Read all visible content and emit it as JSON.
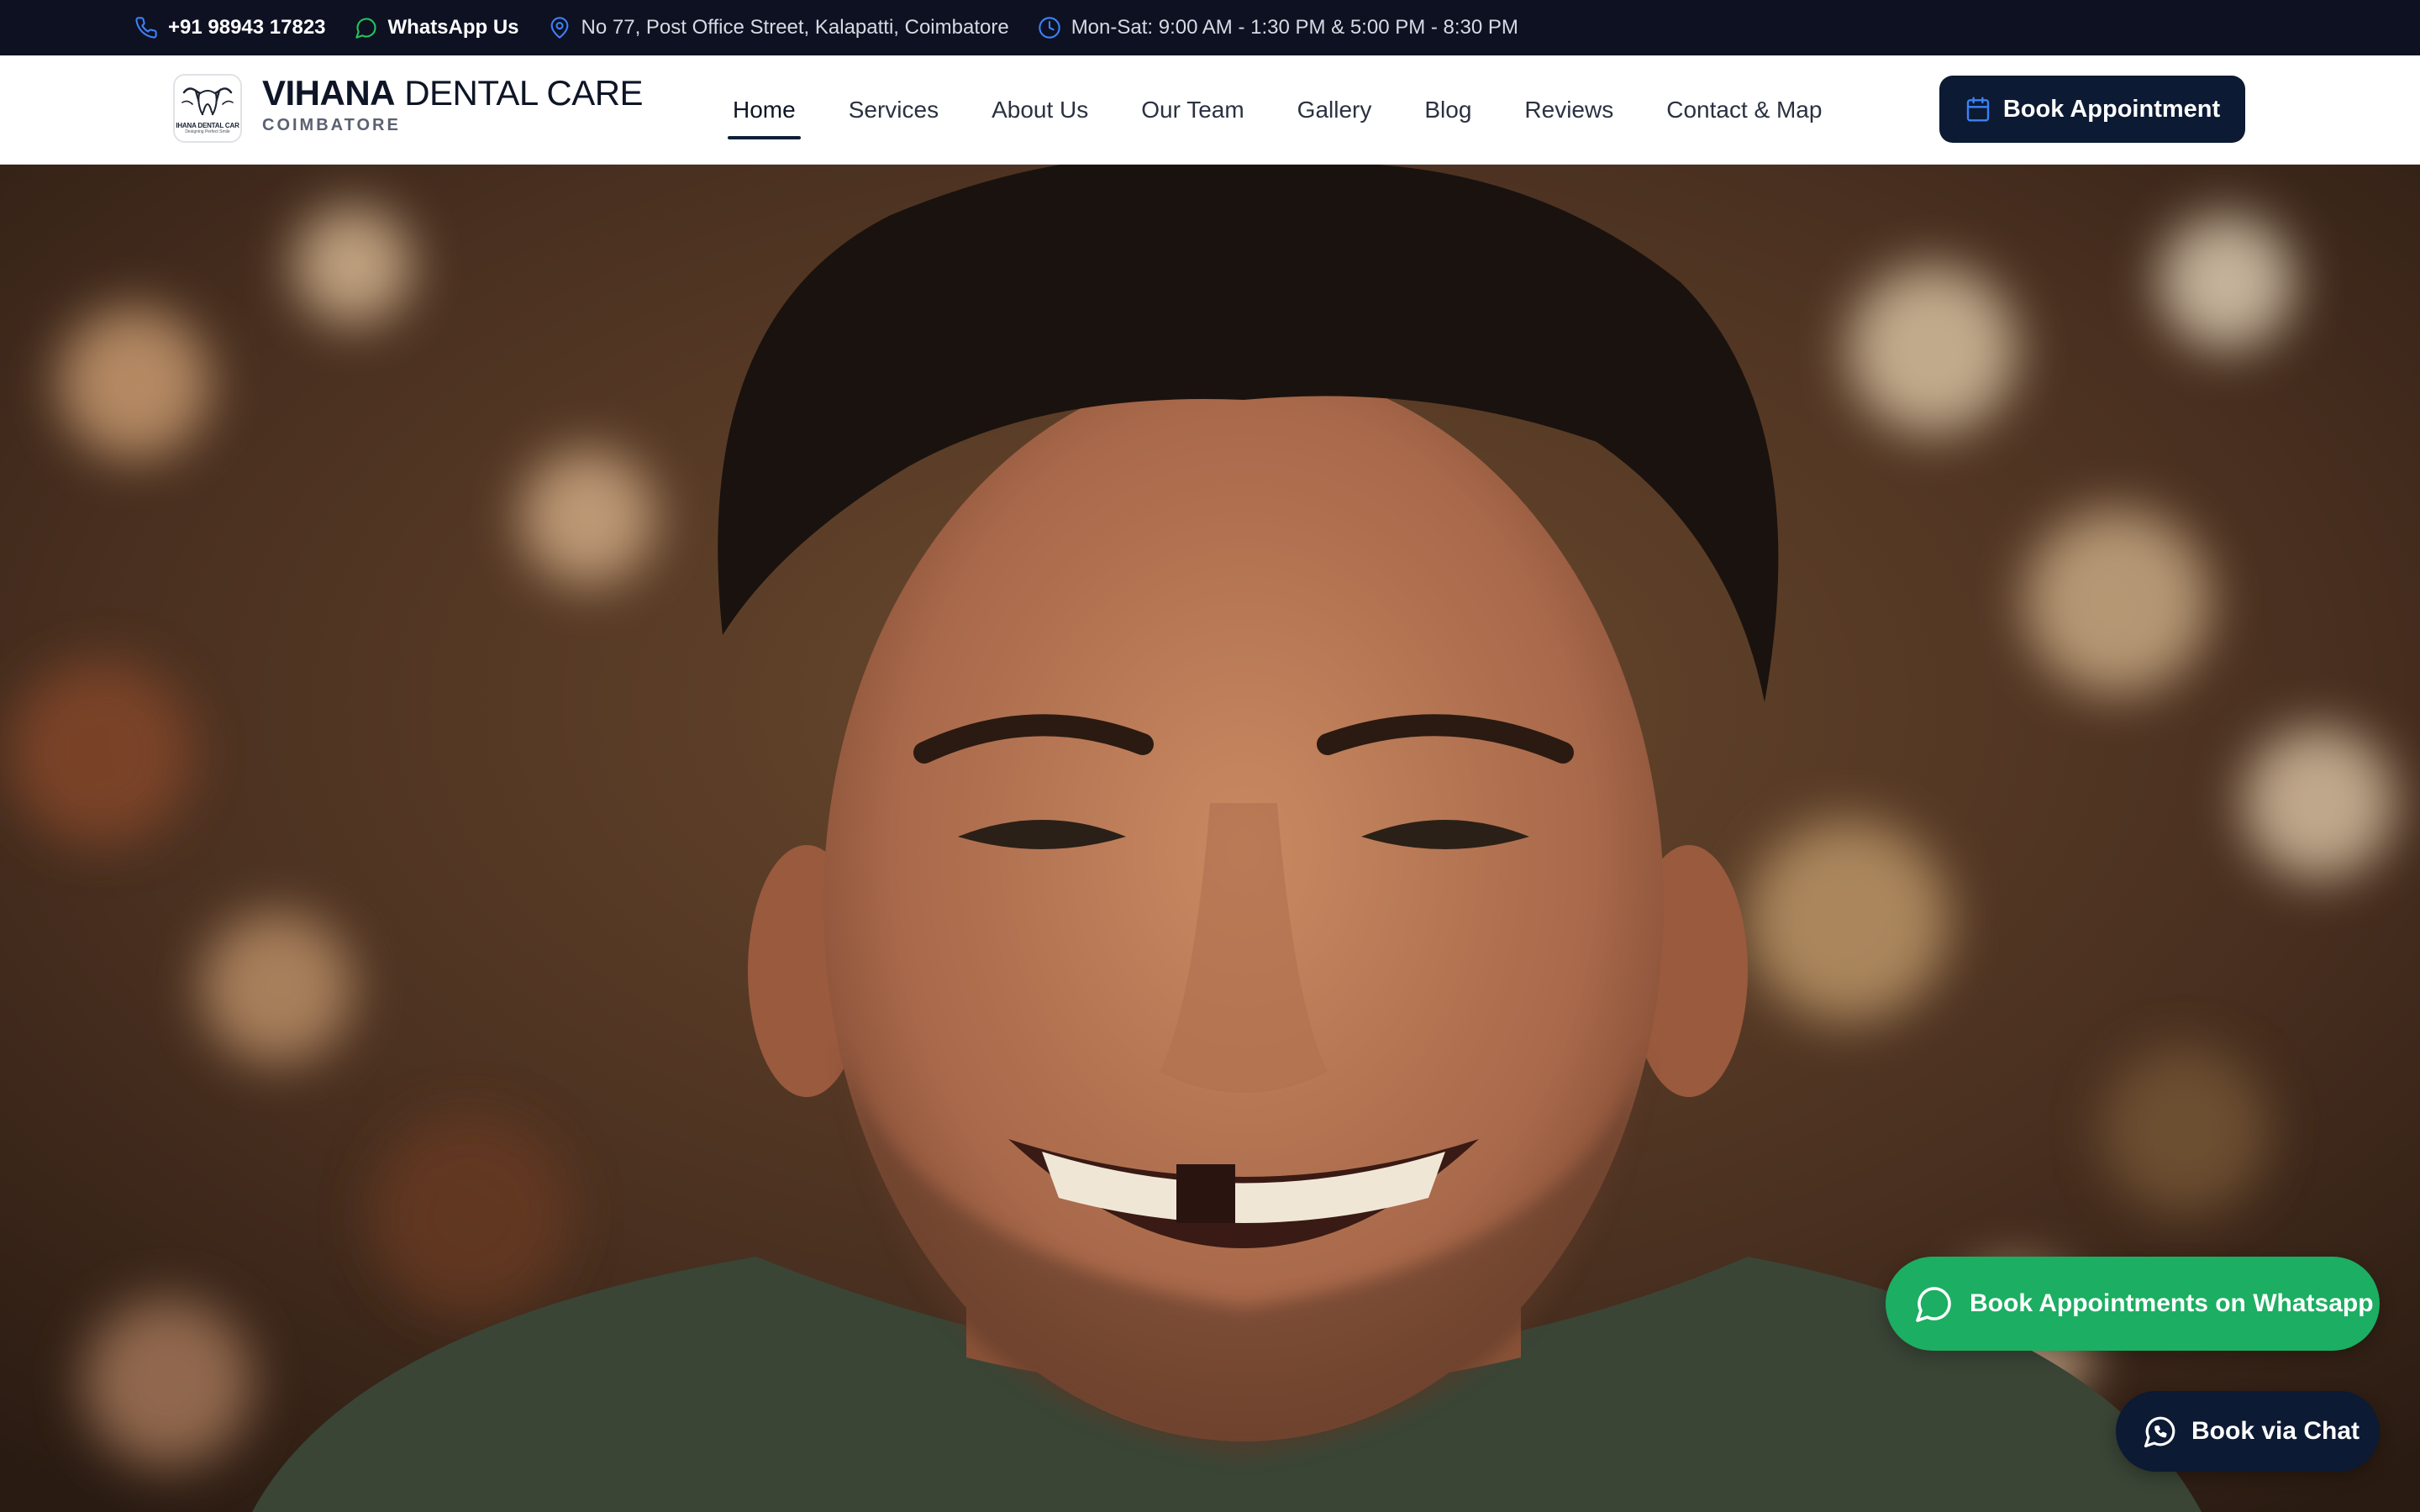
{
  "topbar": {
    "phone": "+91 98943 17823",
    "whatsapp": "WhatsApp Us",
    "address": "No 77, Post Office Street, Kalapatti, Coimbatore",
    "hours": "Mon-Sat: 9:00 AM - 1:30 PM & 5:00 PM - 8:30 PM",
    "icons": [
      "phone-icon",
      "whatsapp-icon",
      "location-pin-icon",
      "clock-icon"
    ]
  },
  "brand": {
    "name_bold": "VIHANA",
    "name_rest": "DENTAL CARE",
    "tagline": "COIMBATORE",
    "logo_text": "IHANA DENTAL CAR",
    "logo_subtext": "Designing Perfect Smile"
  },
  "nav": {
    "items": [
      {
        "label": "Home",
        "active": true
      },
      {
        "label": "Services"
      },
      {
        "label": "About Us"
      },
      {
        "label": "Our Team"
      },
      {
        "label": "Gallery"
      },
      {
        "label": "Blog"
      },
      {
        "label": "Reviews"
      },
      {
        "label": "Contact & Map"
      }
    ]
  },
  "cta": {
    "book_label": "Book Appointment"
  },
  "floating": {
    "whatsapp_label": "Book Appointments on Whatsapp",
    "chat_label": "Book via Chat"
  },
  "colors": {
    "topbar_bg": "#0e1122",
    "brand_dark": "#0c1a33",
    "whatsapp_green": "#1cae62",
    "icon_blue": "#3b82f6"
  }
}
